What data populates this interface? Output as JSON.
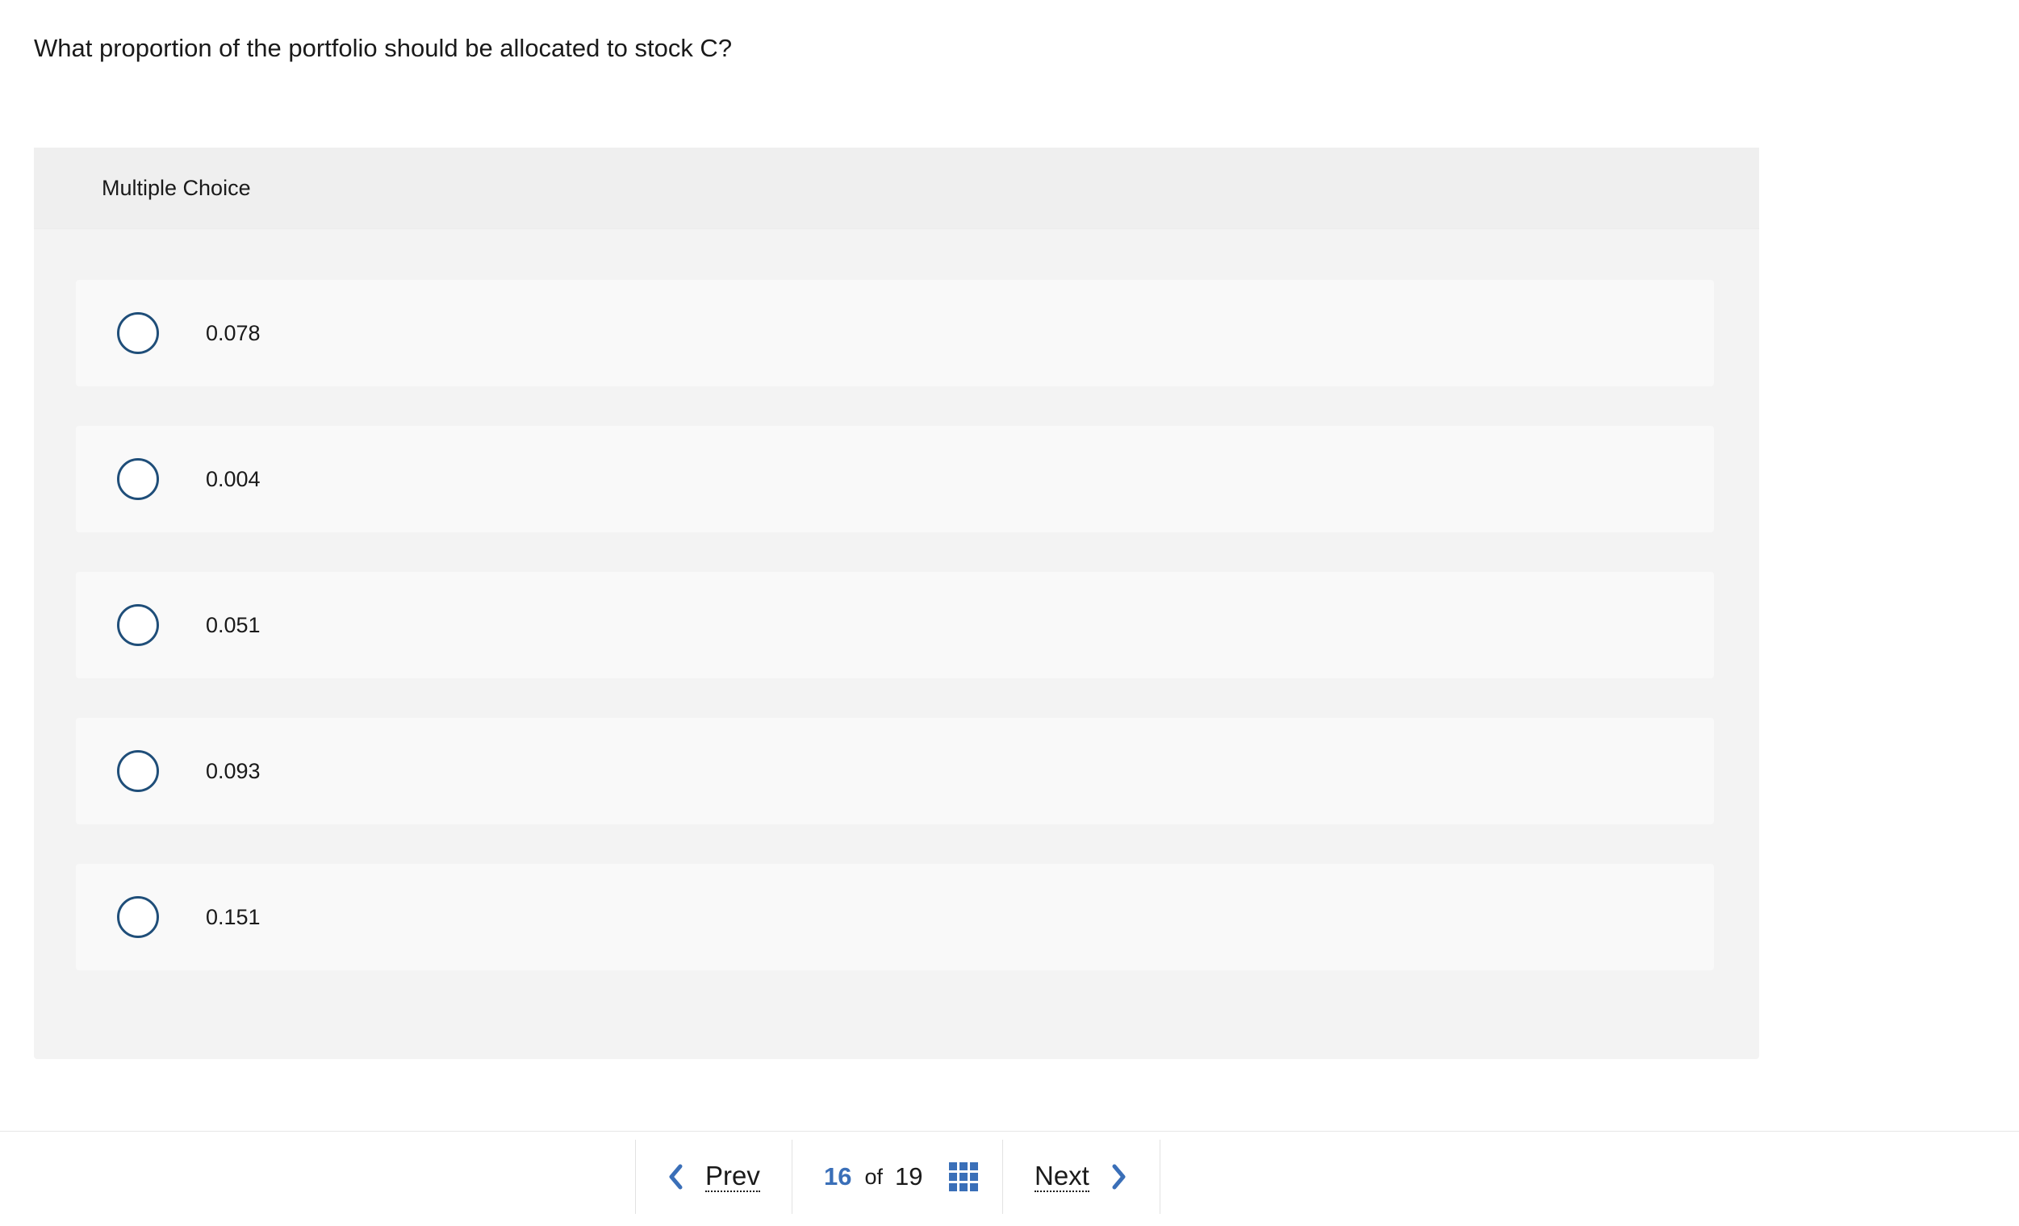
{
  "question": {
    "text": "What proportion of the portfolio should be allocated to stock C?"
  },
  "multiple_choice": {
    "header": "Multiple Choice",
    "options": [
      {
        "label": "0.078",
        "selected": false
      },
      {
        "label": "0.004",
        "selected": false
      },
      {
        "label": "0.051",
        "selected": false
      },
      {
        "label": "0.093",
        "selected": false
      },
      {
        "label": "0.151",
        "selected": false
      }
    ]
  },
  "navigation": {
    "prev_label": "Prev",
    "next_label": "Next",
    "current_page": "16",
    "of_label": "of",
    "total_pages": "19",
    "prev_icon": "chevron-left-icon",
    "next_icon": "chevron-right-icon",
    "grid_icon": "grid-icon"
  },
  "colors": {
    "accent": "#3a6fb8",
    "radio_border": "#1f4e79",
    "panel_background": "#f3f3f3",
    "option_background": "#f9f9f9"
  }
}
